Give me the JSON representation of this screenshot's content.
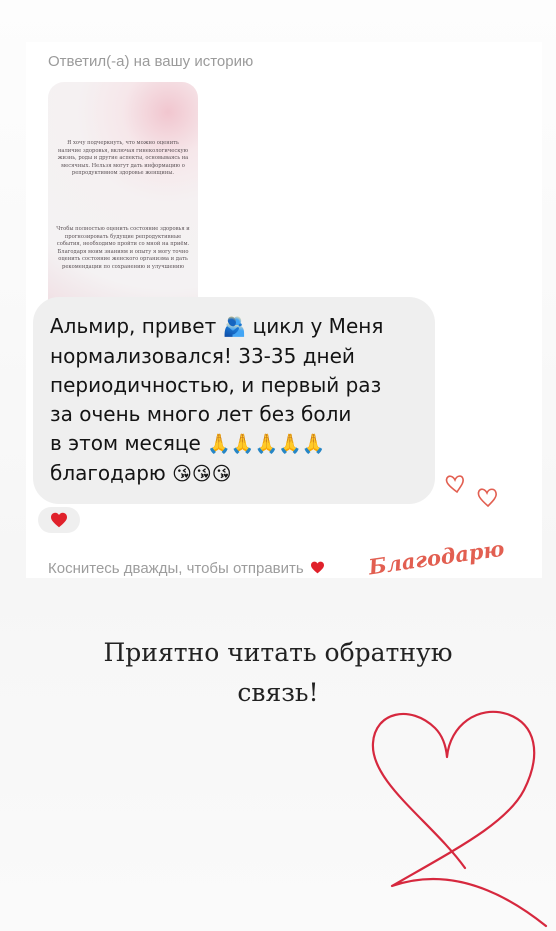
{
  "story_reply": {
    "header": "Ответил(-а) на вашу историю",
    "thumbnail_text": {
      "paragraph_1": "Я хочу подчеркнуть, что можно оценить наличие здоровья, включая гинекологическую жизнь, роды и другие аспекты, основываясь на месячных. Нельзя могут дать информацию о репродуктивном здоровье женщины.",
      "paragraph_2": "Чтобы полностью оценить состояние здоровья и прогнозировать будущие репродуктивные события, необходимо пройти со мной на приём. Благодаря моим знаниям и опыту я могу точно оценить состояние женского организма и дать рекомендации по сохранению и улучшению"
    }
  },
  "message": {
    "line_1": "Альмир, привет",
    "line_1_emoji": "🫂",
    "line_1_tail": "цикл у Меня",
    "line_2": "нормализовался! 33-35 дней",
    "line_3": "периодичностью, и первый раз",
    "line_4": "за очень много лет без боли",
    "line_5": "в этом месяце",
    "line_5_emoji": "🙏🙏🙏🙏🙏",
    "line_6": "благодарю",
    "line_6_emoji": "😘😘😘"
  },
  "reaction": {
    "emoji": "❤️",
    "icon": "heart-icon",
    "color": "#e0212b"
  },
  "footer": {
    "hint": "Коснитесь дважды, чтобы отправить",
    "icon": "heart-icon"
  },
  "sticker": {
    "text": "Благодарю",
    "color": "#e25f51",
    "icon": "hearts-doodle-icon"
  },
  "caption": {
    "line_1": "Приятно читать обратную",
    "line_2": "связь!"
  },
  "decoration": {
    "icon": "scribble-heart-icon",
    "color": "#d6283e"
  }
}
